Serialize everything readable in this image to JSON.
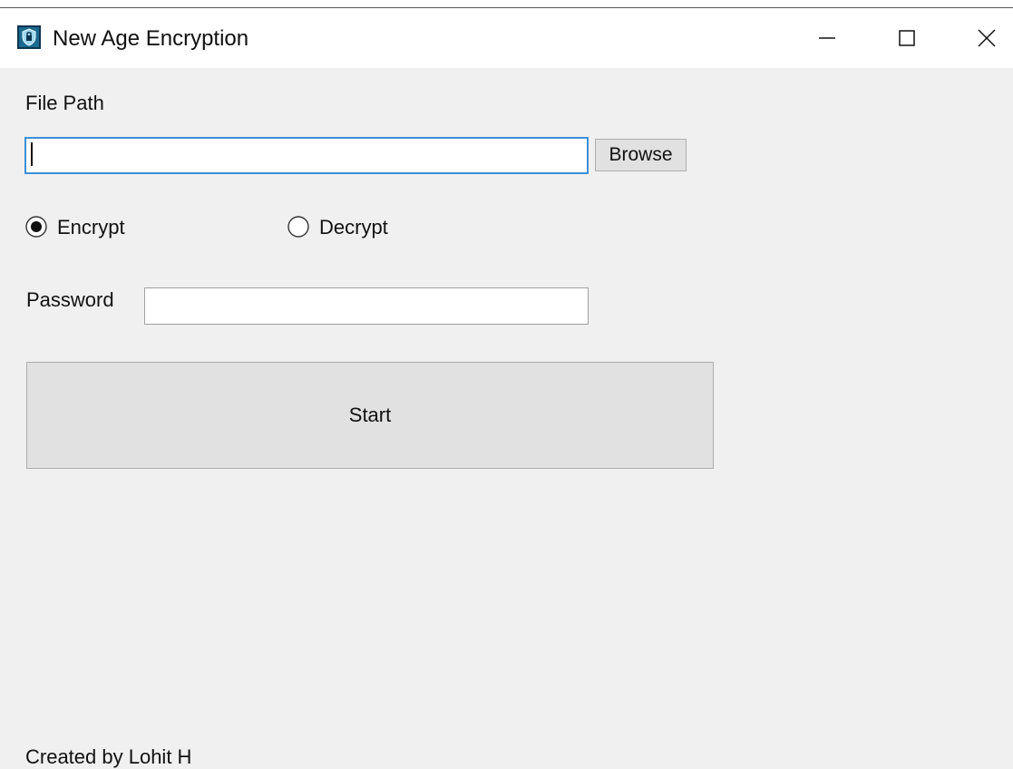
{
  "window": {
    "title": "New Age Encryption",
    "app_icon": "lock-shield-icon",
    "controls": {
      "minimize": "minimize-icon",
      "maximize": "maximize-icon",
      "close": "close-icon"
    }
  },
  "form": {
    "file_path_label": "File Path",
    "file_path_value": "",
    "browse_label": "Browse",
    "mode_options": [
      {
        "label": "Encrypt",
        "selected": true
      },
      {
        "label": "Decrypt",
        "selected": false
      }
    ],
    "password_label": "Password",
    "password_value": "",
    "start_label": "Start"
  },
  "footer": {
    "credit": "Created by Lohit H"
  },
  "colors": {
    "window_bg": "#f0f0f0",
    "titlebar_bg": "#ffffff",
    "focus_border": "#3c8fd6",
    "button_bg": "#e1e1e1"
  }
}
